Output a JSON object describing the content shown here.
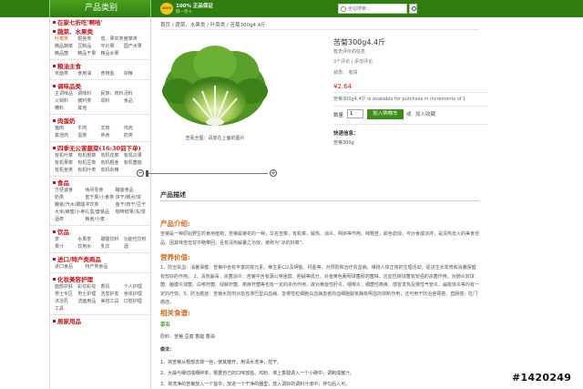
{
  "header": {
    "category_title": "产品类别",
    "guarantee_badge": "100%",
    "guarantee_line1": "100% 正品保证",
    "guarantee_line2": "假一罚十",
    "search_placeholder": "全站搜索..."
  },
  "sidebar": {
    "categories": [
      {
        "title": "在家七折吃'啊哈'",
        "links": []
      },
      {
        "title": "蔬菜、水果类",
        "links": [
          "叶菜类",
          "根茎类",
          "茄、果实类",
          "酱菜类",
          "精品蔬菜",
          "豆制品",
          "平价果",
          "国产水果",
          "精品菌",
          "精品干果",
          "精品水果"
        ]
      },
      {
        "title": "粮油主食",
        "links": [
          "米面类",
          "食用油",
          "食用盐",
          "杂粮"
        ]
      },
      {
        "title": "调味品类",
        "links": [
          "主调味品",
          "调味料",
          "民族、肉料",
          "汤料",
          "火锅料",
          "酱料类",
          "调料",
          "食品",
          "糟料",
          "其他"
        ]
      },
      {
        "title": "肉蛋奶",
        "links": [
          "猪肉",
          "牛肉",
          "羊肉",
          "鸡肉",
          "其他肉",
          "蛋类",
          "熟食",
          "奶类"
        ]
      },
      {
        "title": "四季无公害蔬菜(16:30前下单)",
        "links": [
          "有机叶菜",
          "有机根菜",
          "有机花菜",
          "有机瓜果",
          "有机果菜",
          "有机豆类",
          "有机根茎",
          "有机菌菇",
          "有机茎类",
          "有机叶类",
          "有机杂粮"
        ]
      },
      {
        "title": "食品",
        "links": [
          "方便速食",
          "休闲零食",
          "罐装食品",
          "奶类",
          "蜜干果/小食类",
          "饼干/糕点/饼",
          "罐装/汽水/碳酸饮料",
          "冲饮类",
          "鱼干/肉干/豆干",
          "大米/蜂蜜/小卖",
          "礼盒/套装品",
          "咖啡鲜果/冻/茶",
          "酒类",
          "粮食/小麦"
        ]
      },
      {
        "title": "饮品",
        "links": [
          "茶",
          "水果茶",
          "碳酸饮料",
          "功能性饮料",
          "果汁",
          "饮用水",
          "乳饮",
          "酒"
        ]
      },
      {
        "title": "进口/特产类商品",
        "links": [
          "进口食品",
          "特产类食品"
        ]
      },
      {
        "title": "化妆美容护理",
        "links": [
          "面部护肤",
          "彩妆彩妆",
          "香氛",
          "个人护理",
          "男士专区",
          "男士护理",
          "洗发护发",
          "身体护理",
          "沐浴乳",
          "洁面用品",
          "美容工具",
          "口腔护理",
          "工具"
        ]
      },
      {
        "title": "居家用品",
        "links": []
      }
    ]
  },
  "breadcrumb": "首页 / 蔬菜、水果类 / 叶菜类 / 苦菊300g4.4斤",
  "product": {
    "title": "苦菊300g4.4斤",
    "review_line": "暂无评价的信息",
    "review_link": "3个评论 | 添加评论",
    "stock": "状态： 有货",
    "price": "¥2.64",
    "availability": "苦菊300g4.4斤 is available for purchase in increments of 1",
    "qty_label": "数量",
    "qty_value": "1",
    "add_to_cart": "加入购物车",
    "or": "或",
    "wishlist": "加入收藏",
    "ship_title": "快递信息：",
    "ship_value": "苦菊300g",
    "image_caption": "查看全图：请放在上面的图片"
  },
  "description": {
    "tab": "产品描述",
    "intro_title": "产品介绍:",
    "intro_text": "苦菊是一种原始野生的食用植物，苦菊属菊花的一种，又名苦菜，有机菜，解热、消炎、明目等作用。味略苦，颜色碧绿，可炒食或凉拌，是清热去火的美食佳品。因其味苦但甘中略带回，且有清热解暑之功效，被称为“凉的好菜”。",
    "nutrition_title": "营养价值:",
    "nutrition_text": "1、防治贫血：消暑保健：苦菊中含有丰富的铁元素，维生素C以及钾盐、钙盐等，对预防和治疗贫血病，维持人体正常的生理活动，促进生长发育和消暑保健有较好的作用。 2、清热解毒，杀菌消炎：苦菊中含有蒲公英甾醇、胆碱等成分，对金黄色葡萄球菌耐药菌株、溶血性链球菌有较强的杀菌作用，对肺炎双球菌、脑膜炎球菌、白喉杆菌、绿脓杆菌、痢疾杆菌等也有一定的杀伤作用，故对黄疸性肝炎、咽喉炎、细菌性痢疾、感冒发热及慢性气管炎、扁桃体炎等均有一定的疗效。3、防治癌症：苦菊水煎剂对急性淋巴型白血病、急慢性粒细胞白血病患者的血细胞脱氧酶有明显的抑制作用，还可用于防治宫颈癌、直肠癌、肛门癌症。",
    "recipe_title": "相关食谱:",
    "recipe_sub": "菜名",
    "ingredients": "原料：苦菊 豆腐 香醋 香油",
    "method_title": "做法：",
    "step1": "1、将苦菊从根部去掉一些，使其散开，用清水洗净，控干。",
    "step2": "2、大蒜与细切成细碎末，根据自己的口味放盐、鸡粉、淋上香醋调入一个小碗中，调制成酱汁。",
    "step3": "3、将洗净的苦菊放入一个盆中，放进一个干净的器里，放入调好的调料汁液中，拌匀后入可。"
  },
  "watermark": "#1420249"
}
